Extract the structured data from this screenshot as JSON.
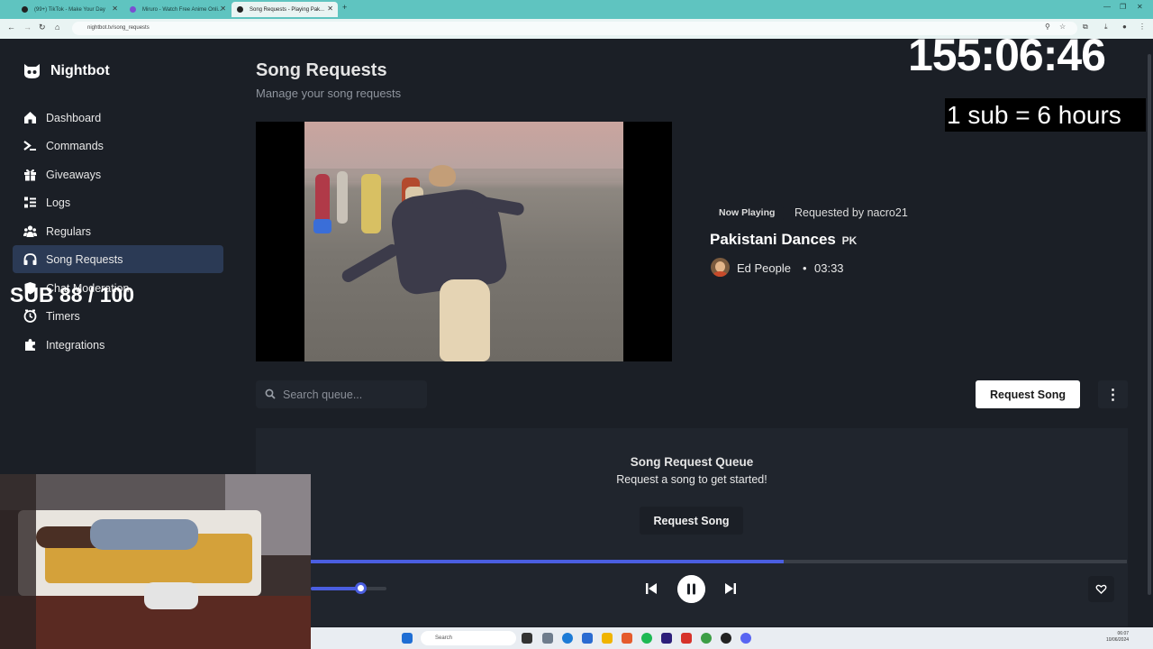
{
  "browser": {
    "tabs": [
      {
        "title": "(99+) TikTok - Make Your Day"
      },
      {
        "title": "Miruro - Watch Free Anime Onli..."
      },
      {
        "title": "Song Requests - Playing Pak..."
      }
    ],
    "new_tab": "+",
    "url": "nightbot.tv/song_requests"
  },
  "sidebar": {
    "brand": "Nightbot",
    "items": [
      {
        "label": "Dashboard",
        "icon": "home-icon"
      },
      {
        "label": "Commands",
        "icon": "terminal-icon"
      },
      {
        "label": "Giveaways",
        "icon": "gift-icon"
      },
      {
        "label": "Logs",
        "icon": "list-icon"
      },
      {
        "label": "Regulars",
        "icon": "users-icon"
      },
      {
        "label": "Song Requests",
        "icon": "headphones-icon",
        "active": true
      },
      {
        "label": "Chat Moderation",
        "icon": "shield-icon"
      },
      {
        "label": "Timers",
        "icon": "clock-icon"
      },
      {
        "label": "Integrations",
        "icon": "puzzle-icon"
      }
    ]
  },
  "main": {
    "title": "Song Requests",
    "subtitle": "Manage your song requests",
    "now_playing": {
      "badge": "Now Playing",
      "requested_by": "Requested by nacro21",
      "song_title": "Pakistani Dances",
      "flag": "PK",
      "artist": "Ed People",
      "separator": "•",
      "duration": "03:33"
    },
    "search": {
      "placeholder": "Search queue..."
    },
    "request_button": "Request Song",
    "more_button": "⋮",
    "queue": {
      "title": "Song Request Queue",
      "empty_message": "Request a song to get started!",
      "request_button": "Request Song"
    },
    "player": {
      "progress_fraction": 0.58,
      "volume_fraction": 0.65
    }
  },
  "overlay": {
    "timer": "155:06:46",
    "sub_rate": "1 sub = 6 hours",
    "sub_goal": "SUB 88 / 100"
  },
  "taskbar": {
    "search_placeholder": "Search",
    "clock_time": "06:07",
    "clock_date": "10/06/2024"
  },
  "colors": {
    "accent": "#4a5ee0",
    "active_nav": "#2b3a55",
    "background": "#1b1f26",
    "panel": "#20252d",
    "browser_chrome": "#5fc4c0"
  }
}
